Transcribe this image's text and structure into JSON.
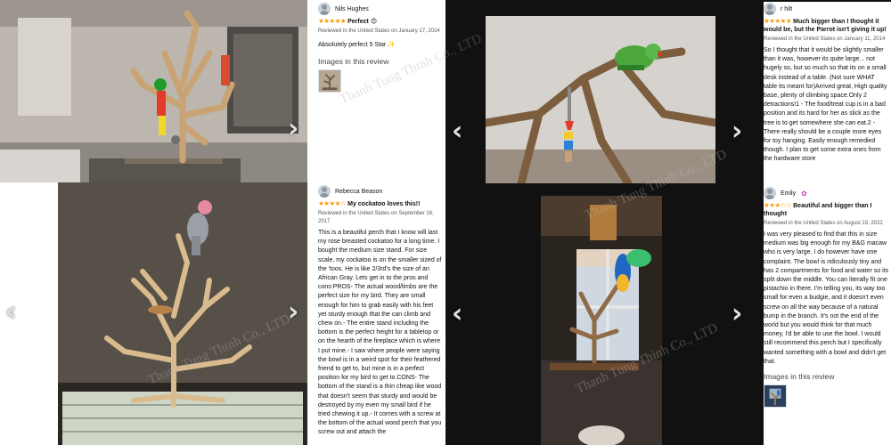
{
  "watermark": "Thanh Tung Thinh Co., LTD",
  "nav": {
    "prev_icon": "‹",
    "next_icon": "›"
  },
  "reviews": [
    {
      "name": "Nils Hughes",
      "rating": 5,
      "stars": "★★★★★",
      "title": "Perfect",
      "title_emoji": "😍",
      "meta": "Reviewed in the United States on January 17, 2024",
      "body": "Absolutely perfect 5 Star ✨",
      "images_heading": "Images in this review"
    },
    {
      "name": "Rebecca Beason",
      "rating": 4,
      "stars": "★★★★☆",
      "title": "My cockatoo loves this!!",
      "meta": "Reviewed in the United States on September 16, 2017",
      "body": "This is a beautiful perch that I know will last my rose breasted cockatoo for a long time. I bought the medium size stand. For size scale, my cockatoo is on the smaller sized of the 'toos. He is like 2/3rd's the size of an African Gray. Lets get in to the pros and cons:PROS- The actual wood/limbs are the perfect size for my bird. They are small enough for him to grab easily with his feet yet sturdy enough that the can climb and chew on.- The entire stand including the bottom is the perfect height for a tabletop or on the hearth of the fireplace which is where I put mine.- I saw where people were saying the bowl is in a weird spot for their feathered friend to get to, but mine is in a perfect position for my bird to get to.CONS- The bottom of the stand is a thin cheap like wood that doesn't seem that sturdy and would be destroyed by my even my small bird if he tried chewing it up.- It comes with a screw at the bottom of the actual wood perch that you screw out and attach the"
    },
    {
      "name": "r hilt",
      "rating": 5,
      "stars": "★★★★★",
      "title": "Much bigger than I thought it would be, but the Parrot isn't giving it up!",
      "meta": "Reviewed in the United States on January 11, 2014",
      "body": "So I thought that it would be slightly smaller than it was, however its quite large... not hugely so, but so much so that its on a small desk instead of a table. (Not sure WHAT table its meant for)Arrived great, High quality base, plenty of climbing space.Only 2 detractions!1 - The food/treat cup is in a bad position and its hard for her as slick as the tree is to get somewhere she can eat.2 - There really should be a couple more eyes for toy hanging. Easily enough remedied though. I plan to get some extra ones from the hardware store"
    },
    {
      "name": "Emily",
      "badge": "✿",
      "rating": 3,
      "stars": "★★★☆☆",
      "title": "Beautiful and bigger than I thought",
      "meta": "Reviewed in the United States on August 19, 2022",
      "body": "I was very pleased to find that this in size medium was big enough for my B&G macaw who is very large. I do however have one complaint. The bowl is ridiculously tiny and has 2 compartments for food and water so its split down the middle. You can literally fit one pistachio in there. I'm telling you, its way too small for even a budgie, and it doesn't even screw on all the way because of a natural bump in the branch. It's not the end of the world but you would think for that much money, I'd be able to use the bowl. I would still recommend this perch but I specifically wanted something with a bowl and didn't get that.",
      "images_heading": "Images in this review"
    }
  ],
  "colors": {
    "star": "#ff9900",
    "meta": "#565959",
    "dark_bg": "#111111",
    "arrow": "#e0e0e0"
  }
}
